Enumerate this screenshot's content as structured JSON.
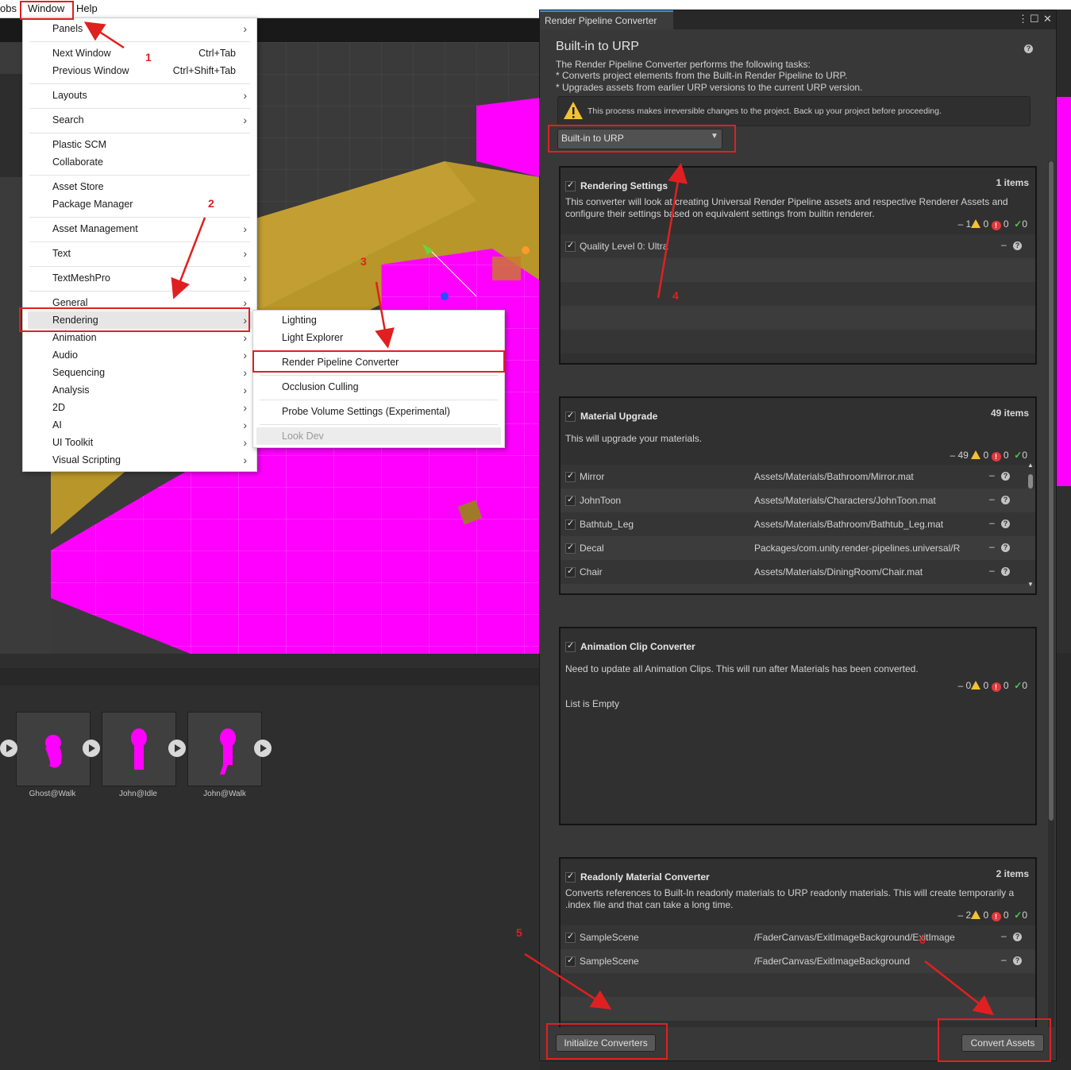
{
  "menubar": {
    "items": [
      "obs",
      "Window",
      "Help"
    ]
  },
  "window_menu": {
    "items": [
      {
        "label": "Panels",
        "shortcut": "",
        "submenu": true
      },
      {
        "label": "Next Window",
        "shortcut": "Ctrl+Tab",
        "submenu": false
      },
      {
        "label": "Previous Window",
        "shortcut": "Ctrl+Shift+Tab",
        "submenu": false
      },
      {
        "label": "Layouts",
        "shortcut": "",
        "submenu": true
      },
      {
        "label": "Search",
        "shortcut": "",
        "submenu": true
      },
      {
        "label": "Plastic SCM",
        "shortcut": "",
        "submenu": false
      },
      {
        "label": "Collaborate",
        "shortcut": "",
        "submenu": false
      },
      {
        "label": "Asset Store",
        "shortcut": "",
        "submenu": false
      },
      {
        "label": "Package Manager",
        "shortcut": "",
        "submenu": false
      },
      {
        "label": "Asset Management",
        "shortcut": "",
        "submenu": true
      },
      {
        "label": "Text",
        "shortcut": "",
        "submenu": true
      },
      {
        "label": "TextMeshPro",
        "shortcut": "",
        "submenu": true
      },
      {
        "label": "General",
        "shortcut": "",
        "submenu": true
      },
      {
        "label": "Rendering",
        "shortcut": "",
        "submenu": true
      },
      {
        "label": "Animation",
        "shortcut": "",
        "submenu": true
      },
      {
        "label": "Audio",
        "shortcut": "",
        "submenu": true
      },
      {
        "label": "Sequencing",
        "shortcut": "",
        "submenu": true
      },
      {
        "label": "Analysis",
        "shortcut": "",
        "submenu": true
      },
      {
        "label": "2D",
        "shortcut": "",
        "submenu": true
      },
      {
        "label": "AI",
        "shortcut": "",
        "submenu": true
      },
      {
        "label": "UI Toolkit",
        "shortcut": "",
        "submenu": true
      },
      {
        "label": "Visual Scripting",
        "shortcut": "",
        "submenu": true
      }
    ]
  },
  "rendering_submenu": {
    "items": [
      "Lighting",
      "Light Explorer",
      "Render Pipeline Converter",
      "Occlusion Culling",
      "Probe Volume Settings (Experimental)",
      "Look Dev"
    ]
  },
  "animations": {
    "clips": [
      "Ghost@Walk",
      "John@Idle",
      "John@Walk"
    ]
  },
  "converter": {
    "tab_title": "Render Pipeline Converter",
    "heading": "Built-in to URP",
    "intro": [
      "The Render Pipeline Converter performs the following tasks:",
      "* Converts project elements from the Built-in Render Pipeline to URP.",
      "* Upgrades assets from earlier URP versions to the current URP version."
    ],
    "warning": "This process makes irreversible changes to the project. Back up your project before proceeding.",
    "dropdown_value": "Built-in to URP",
    "sections": [
      {
        "title": "Rendering Settings",
        "count": "1 items",
        "description": "This converter will look at creating Universal Render Pipeline assets and respective Renderer Assets and configure their settings based on equivalent settings from builtin renderer.",
        "stats": {
          "pending": "1",
          "warnings": "0",
          "errors": "0",
          "success": "0"
        },
        "rows": [
          {
            "name": "Quality Level 0: Ultra",
            "path": ""
          }
        ]
      },
      {
        "title": "Material Upgrade",
        "count": "49 items",
        "description": "This will upgrade your materials.",
        "stats": {
          "pending": "49",
          "warnings": "0",
          "errors": "0",
          "success": "0"
        },
        "rows": [
          {
            "name": "Mirror",
            "path": "Assets/Materials/Bathroom/Mirror.mat"
          },
          {
            "name": "JohnToon",
            "path": "Assets/Materials/Characters/JohnToon.mat"
          },
          {
            "name": "Bathtub_Leg",
            "path": "Assets/Materials/Bathroom/Bathtub_Leg.mat"
          },
          {
            "name": "Decal",
            "path": "Packages/com.unity.render-pipelines.universal/R"
          },
          {
            "name": "Chair",
            "path": "Assets/Materials/DiningRoom/Chair.mat"
          }
        ]
      },
      {
        "title": "Animation Clip Converter",
        "count": "",
        "description": "Need to update all Animation Clips. This will run after Materials has been converted.",
        "stats": {
          "pending": "0",
          "warnings": "0",
          "errors": "0",
          "success": "0"
        },
        "empty_text": "List is Empty",
        "rows": []
      },
      {
        "title": "Readonly Material Converter",
        "count": "2 items",
        "description": "Converts references to Built-In readonly materials to URP readonly materials. This will create temporarily a .index file and that can take a long time.",
        "stats": {
          "pending": "2",
          "warnings": "0",
          "errors": "0",
          "success": "0"
        },
        "rows": [
          {
            "name": "SampleScene",
            "path": "/FaderCanvas/ExitImageBackground/ExitImage"
          },
          {
            "name": "SampleScene",
            "path": "/FaderCanvas/ExitImageBackground"
          }
        ]
      }
    ],
    "buttons": {
      "initialize": "Initialize Converters",
      "convert": "Convert Assets"
    }
  },
  "annotations": [
    "1",
    "2",
    "3",
    "4",
    "5",
    "6"
  ],
  "colors": {
    "annotation_red": "#e02020",
    "magenta_material": "#ff00ff",
    "floor_yellow": "#b8962a",
    "warning_yellow": "#f2c230",
    "error_red": "#e0393d",
    "success_green": "#4cc94c"
  }
}
